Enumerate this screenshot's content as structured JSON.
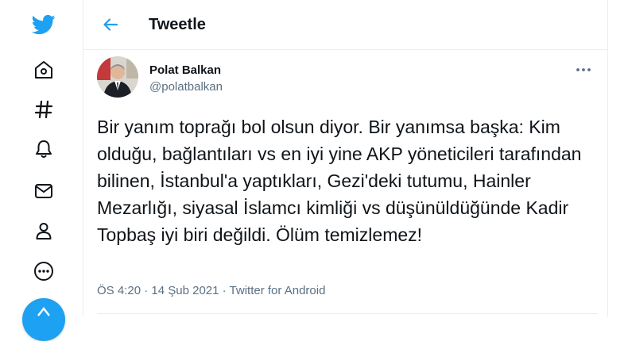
{
  "sidebar": {
    "items": [
      {
        "icon": "twitter-logo-icon"
      },
      {
        "icon": "home-icon"
      },
      {
        "icon": "explore-hashtag-icon"
      },
      {
        "icon": "notifications-bell-icon"
      },
      {
        "icon": "messages-envelope-icon"
      },
      {
        "icon": "profile-icon"
      },
      {
        "icon": "more-circle-icon"
      },
      {
        "icon": "compose-tweet-icon"
      }
    ],
    "accent_color": "#1da1f2"
  },
  "header": {
    "title": "Tweetle"
  },
  "tweet": {
    "author_name": "Polat Balkan",
    "author_handle": "@polatbalkan",
    "text": "Bir yanım toprağı bol olsun diyor. Bir yanımsa başka: Kim olduğu, bağlantıları vs en iyi yine AKP yöneticileri tarafından bilinen, İstanbul'a yaptıkları, Gezi'deki tutumu, Hainler Mezarlığı, siyasal İslamcı kimliği vs düşünüldüğünde Kadir Topbaş iyi biri değildi. Ölüm temizlemez!",
    "time": "ÖS 4:20",
    "separator": "·",
    "date": "14 Şub 2021",
    "source": "Twitter for Android"
  },
  "colors": {
    "text": "#0f1419",
    "secondary_text": "#5b7083",
    "border": "#ebeef0"
  }
}
